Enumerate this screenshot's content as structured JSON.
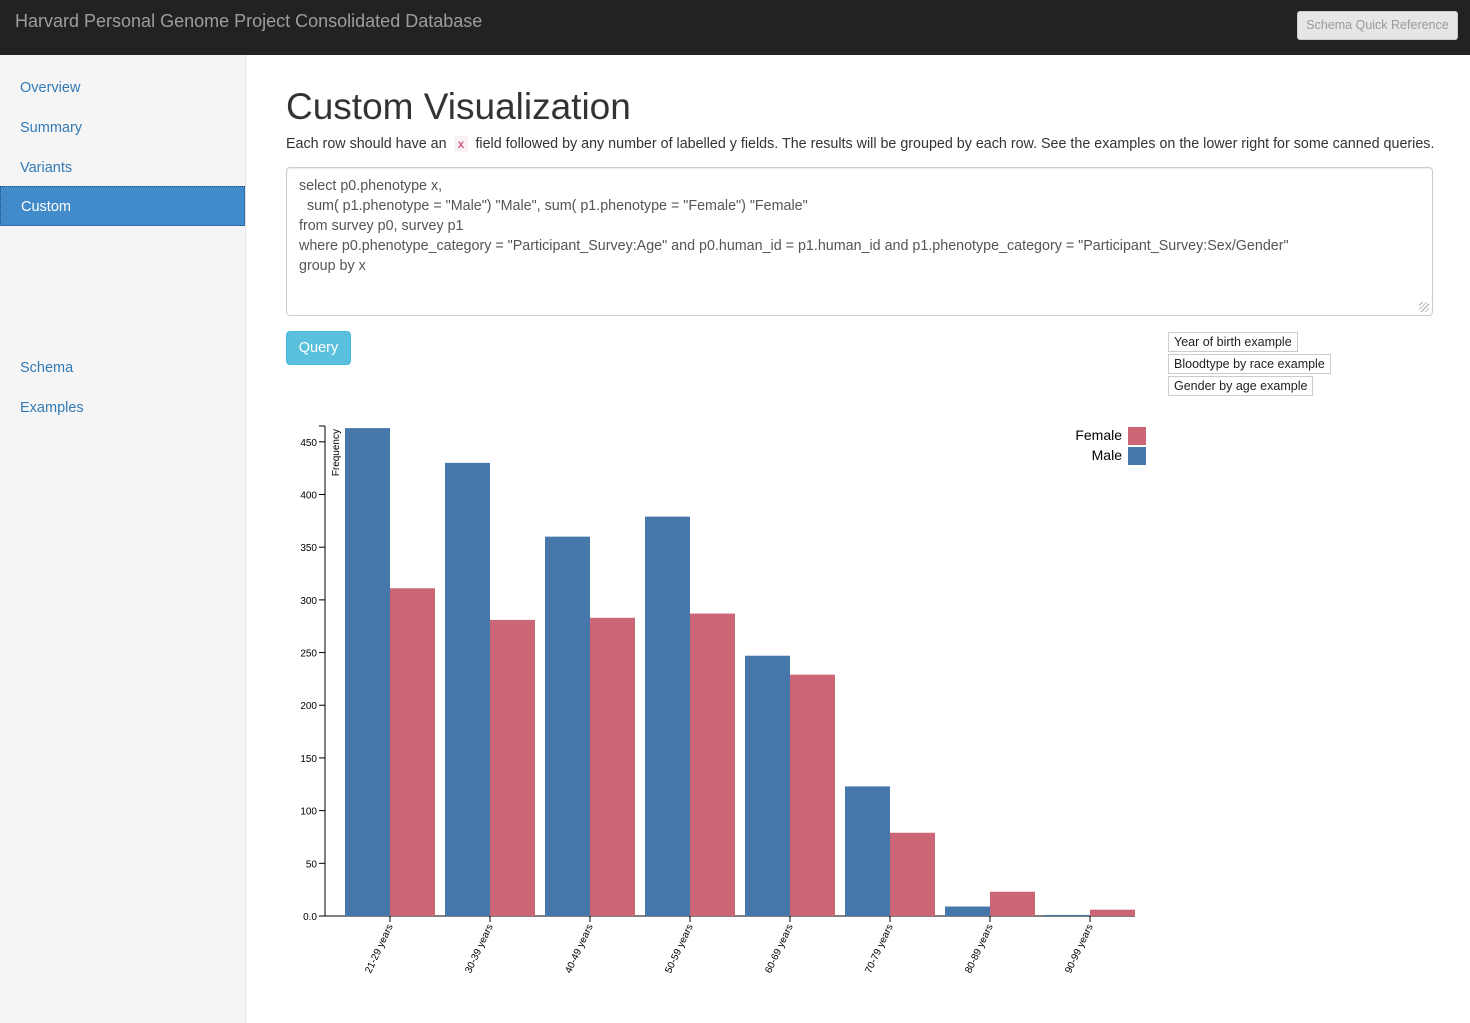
{
  "navbar": {
    "title": "Harvard Personal Genome Project Consolidated Database",
    "schema_button": "Schema Quick Reference"
  },
  "sidebar": {
    "items": [
      {
        "label": "Overview",
        "active": false
      },
      {
        "label": "Summary",
        "active": false
      },
      {
        "label": "Variants",
        "active": false
      },
      {
        "label": "Custom",
        "active": true
      },
      {
        "label": "Schema",
        "active": false
      },
      {
        "label": "Examples",
        "active": false
      }
    ]
  },
  "main": {
    "title": "Custom Visualization",
    "desc_before": "Each row should have an",
    "desc_code": "x",
    "desc_after": "field followed by any number of labelled y fields. The results will be grouped by each row. See the examples on the lower right for some canned queries.",
    "query_text": "select p0.phenotype x,\n  sum( p1.phenotype = \"Male\") \"Male\", sum( p1.phenotype = \"Female\") \"Female\"\nfrom survey p0, survey p1\nwhere p0.phenotype_category = \"Participant_Survey:Age\" and p0.human_id = p1.human_id and p1.phenotype_category = \"Participant_Survey:Sex/Gender\"\ngroup by x",
    "query_button": "Query",
    "examples": [
      "Year of birth example",
      "Bloodtype by race example",
      "Gender by age example"
    ]
  },
  "chart_data": {
    "type": "bar",
    "categories": [
      "21-29 years",
      "30-39 years",
      "40-49 years",
      "50-59 years",
      "60-69 years",
      "70-79 years",
      "80-89 years",
      "90-99 years"
    ],
    "series": [
      {
        "name": "Male",
        "color": "#4677aa",
        "values": [
          463,
          430,
          360,
          379,
          247,
          123,
          9,
          1
        ]
      },
      {
        "name": "Female",
        "color": "#cc6677",
        "values": [
          311,
          281,
          283,
          287,
          229,
          79,
          23,
          6
        ]
      }
    ],
    "ylabel": "Frequency",
    "yticks": [
      "0.0",
      "50",
      "100",
      "150",
      "200",
      "250",
      "300",
      "350",
      "400",
      "450"
    ],
    "ylim": [
      0,
      465
    ],
    "legend": [
      "Female",
      "Male"
    ],
    "legend_position": "top-right",
    "grid": false
  }
}
